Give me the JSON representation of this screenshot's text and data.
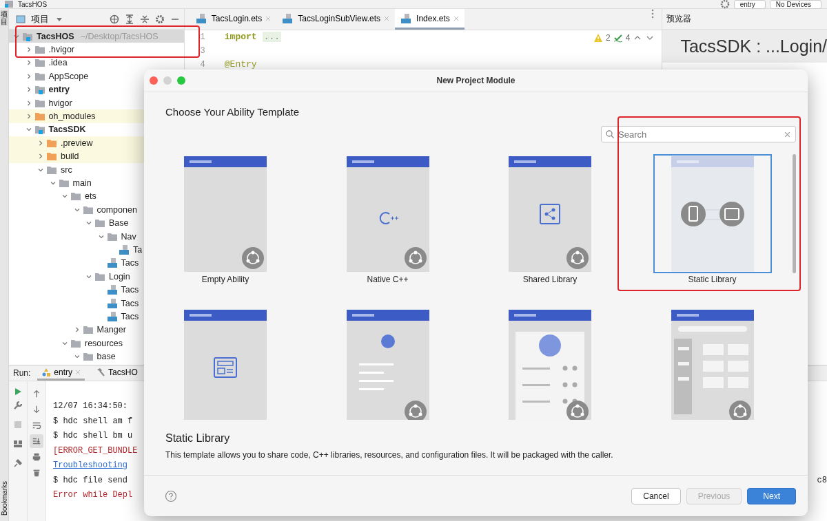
{
  "title_bar": {
    "project": "TacsHOS",
    "run_config": "entry",
    "device": "No Devices"
  },
  "side_strip": {
    "project_tab": "项目",
    "bookmarks_tab": "Bookmarks"
  },
  "project_panel": {
    "title": "项目",
    "tree": [
      {
        "name": "TacsHOS",
        "path": "~/Desktop/TacsHOS",
        "kind": "module",
        "expanded": true,
        "selected": true,
        "ignored": false,
        "children": [
          {
            "name": ".hvigor",
            "kind": "folder",
            "expanded": false,
            "selected": false,
            "ignored": false
          },
          {
            "name": ".idea",
            "kind": "folder",
            "expanded": false,
            "selected": false,
            "ignored": false
          },
          {
            "name": "AppScope",
            "kind": "folder",
            "expanded": false,
            "selected": false,
            "ignored": false
          },
          {
            "name": "entry",
            "kind": "module",
            "expanded": false,
            "selected": false,
            "ignored": false
          },
          {
            "name": "hvigor",
            "kind": "folder",
            "expanded": false,
            "selected": false,
            "ignored": false
          },
          {
            "name": "oh_modules",
            "kind": "excluded",
            "expanded": false,
            "selected": false,
            "ignored": true
          },
          {
            "name": "TacsSDK",
            "kind": "module",
            "expanded": true,
            "selected": false,
            "ignored": false,
            "children": [
              {
                "name": ".preview",
                "kind": "excluded",
                "expanded": false,
                "selected": false,
                "ignored": true
              },
              {
                "name": "build",
                "kind": "excluded",
                "expanded": false,
                "selected": false,
                "ignored": true
              },
              {
                "name": "src",
                "kind": "folder",
                "expanded": true,
                "selected": false,
                "ignored": false,
                "children": [
                  {
                    "name": "main",
                    "kind": "folder",
                    "expanded": true,
                    "selected": false,
                    "ignored": false,
                    "children": [
                      {
                        "name": "ets",
                        "kind": "folder",
                        "expanded": true,
                        "selected": false,
                        "ignored": false,
                        "children": [
                          {
                            "name": "componen",
                            "kind": "folder",
                            "expanded": true,
                            "selected": false,
                            "ignored": false,
                            "children": [
                              {
                                "name": "Base",
                                "kind": "folder",
                                "expanded": true,
                                "selected": false,
                                "ignored": false,
                                "children": [
                                  {
                                    "name": "Nav",
                                    "kind": "folder",
                                    "expanded": true,
                                    "selected": false,
                                    "ignored": false,
                                    "children": [
                                      {
                                        "name": "Ta",
                                        "kind": "file",
                                        "selected": false,
                                        "ignored": false
                                      }
                                    ]
                                  },
                                  {
                                    "name": "Tacs",
                                    "kind": "file",
                                    "selected": false,
                                    "ignored": false
                                  }
                                ]
                              },
                              {
                                "name": "Login",
                                "kind": "folder",
                                "expanded": true,
                                "selected": false,
                                "ignored": false,
                                "children": [
                                  {
                                    "name": "Tacs",
                                    "kind": "file",
                                    "selected": false,
                                    "ignored": false
                                  },
                                  {
                                    "name": "Tacs",
                                    "kind": "file",
                                    "selected": false,
                                    "ignored": false
                                  },
                                  {
                                    "name": "Tacs",
                                    "kind": "file",
                                    "selected": false,
                                    "ignored": false
                                  }
                                ]
                              }
                            ]
                          },
                          {
                            "name": "Manger",
                            "kind": "folder",
                            "expanded": false,
                            "selected": false,
                            "ignored": false
                          }
                        ]
                      },
                      {
                        "name": "resources",
                        "kind": "folder",
                        "expanded": true,
                        "selected": false,
                        "ignored": false,
                        "children": [
                          {
                            "name": "base",
                            "kind": "folder",
                            "expanded": true,
                            "selected": false,
                            "ignored": false
                          }
                        ]
                      }
                    ]
                  }
                ]
              }
            ]
          }
        ]
      }
    ]
  },
  "editor": {
    "tabs": [
      {
        "label": "TacsLogin.ets",
        "selected": false
      },
      {
        "label": "TacsLoginSubView.ets",
        "selected": false
      },
      {
        "label": "Index.ets",
        "selected": true
      }
    ],
    "lines": [
      {
        "number": "1",
        "kind": "import",
        "text": "import",
        "fold": "..."
      },
      {
        "number": "3"
      },
      {
        "number": "4",
        "kind": "annotation",
        "text": "@Entry"
      }
    ],
    "inspection": {
      "warnings": "2",
      "passed": "4"
    }
  },
  "preview": {
    "title": "预览器",
    "heading": "TacsSDK : ...Login/"
  },
  "run": {
    "label": "Run:",
    "tabs": [
      {
        "label": "entry",
        "kind": "config",
        "selected": true
      },
      {
        "label": "TacsHO",
        "kind": "build",
        "selected": false
      }
    ],
    "tools": [
      {
        "kind": "up",
        "on": false
      },
      {
        "kind": "down",
        "on": false
      },
      {
        "kind": "wrap",
        "on": false
      },
      {
        "kind": "scroll-end",
        "on": true
      },
      {
        "kind": "print",
        "on": false
      },
      {
        "kind": "trash",
        "on": false
      }
    ],
    "lines": [
      {
        "text": "12/07 16:34:50:",
        "kind": "normal"
      },
      {
        "text": "$ hdc shell am f",
        "kind": "normal"
      },
      {
        "text": "$ hdc shell bm u",
        "kind": "normal"
      },
      {
        "text": "[ERROR_GET_BUNDLE",
        "kind": "error"
      },
      {
        "text": "Troubleshooting",
        "kind": "link"
      },
      {
        "text": "$ hdc file send",
        "kind": "normal",
        "tail": "c8"
      },
      {
        "text": "Error while Depl",
        "kind": "error"
      }
    ]
  },
  "dialog": {
    "title": "New Project Module",
    "heading": "Choose Your Ability Template",
    "search": {
      "placeholder": "Search"
    },
    "templates": [
      {
        "kind": "empty",
        "label": "Empty Ability",
        "selected": false,
        "badge": true
      },
      {
        "kind": "cpp",
        "label": "Native C++",
        "selected": false,
        "badge": true
      },
      {
        "kind": "shared",
        "label": "Shared Library",
        "selected": false,
        "badge": true
      },
      {
        "kind": "static",
        "label": "Static Library",
        "selected": true,
        "badge": false
      },
      {
        "kind": "form",
        "selected": false,
        "badge": false
      },
      {
        "kind": "profile",
        "selected": false,
        "badge": true
      },
      {
        "kind": "detail",
        "selected": false,
        "badge": true
      },
      {
        "kind": "grid",
        "selected": false,
        "badge": true
      }
    ],
    "description": {
      "title": "Static Library",
      "text": "This template allows you to share code, C++ libraries, resources, and configuration files. It will be packaged with the caller."
    },
    "buttons": [
      {
        "label": "Cancel",
        "kind": "default",
        "disabled": false
      },
      {
        "label": "Previous",
        "kind": "default",
        "disabled": true
      },
      {
        "label": "Next",
        "kind": "primary",
        "disabled": false
      }
    ]
  }
}
